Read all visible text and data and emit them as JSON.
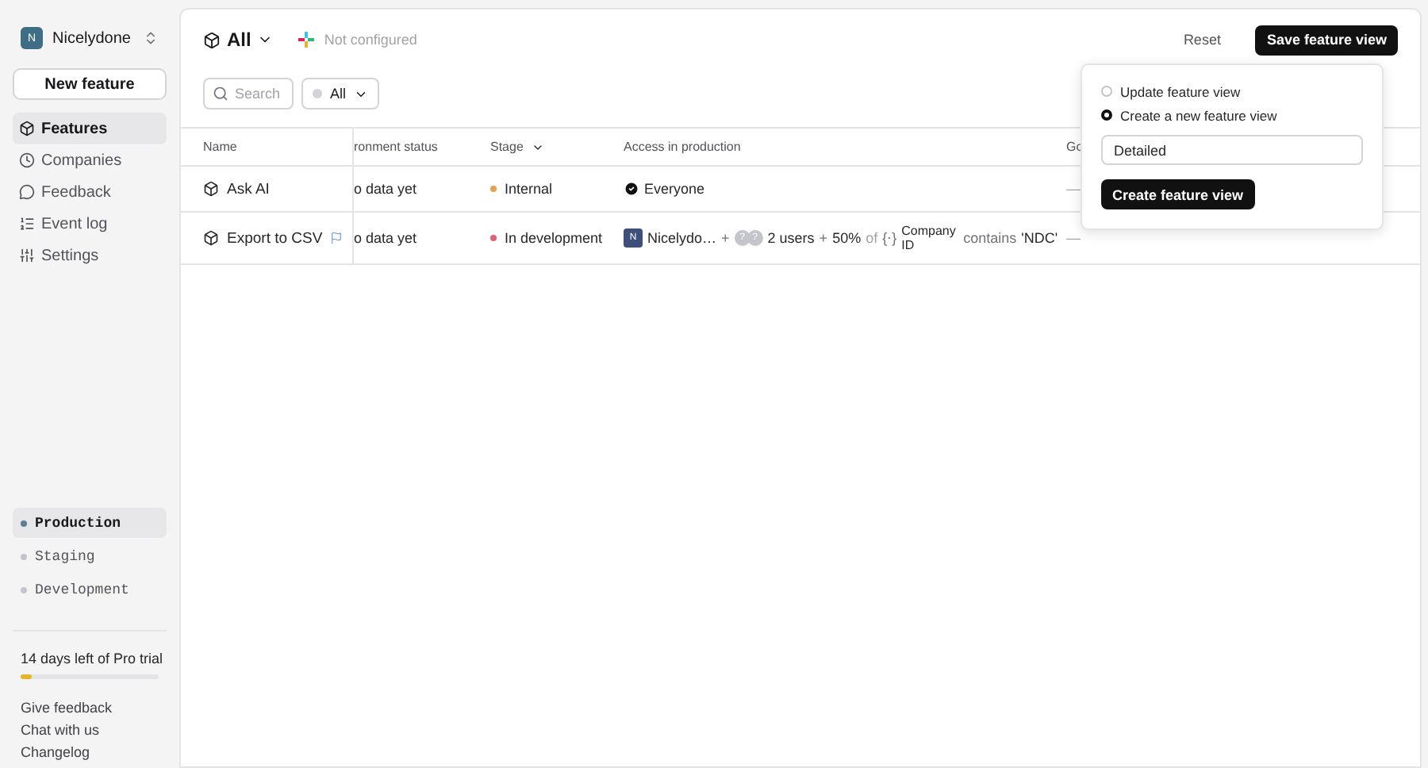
{
  "org": {
    "initial": "N",
    "name": "Nicelydone"
  },
  "new_feature": "New feature",
  "nav": [
    {
      "label": "Features",
      "selected": true
    },
    {
      "label": "Companies",
      "selected": false
    },
    {
      "label": "Feedback",
      "selected": false
    },
    {
      "label": "Event log",
      "selected": false
    },
    {
      "label": "Settings",
      "selected": false
    }
  ],
  "environments": [
    {
      "label": "Production",
      "selected": true
    },
    {
      "label": "Staging",
      "selected": false
    },
    {
      "label": "Development",
      "selected": false
    }
  ],
  "trial": {
    "text": "14 days left of Pro trial",
    "level": 0.08
  },
  "footer_links": [
    "Give feedback",
    "Chat with us",
    "Changelog"
  ],
  "header": {
    "view": "All",
    "slack": "Not configured",
    "reset": "Reset",
    "save": "Save feature view"
  },
  "filters": {
    "search_placeholder": "Search",
    "status": "All"
  },
  "table": {
    "columns": [
      "Name",
      "ronment status",
      "Stage",
      "Access in production",
      "Go"
    ],
    "rows": [
      {
        "name": "Ask AI",
        "flag": false,
        "env": "o data yet",
        "stage": {
          "label": "Internal",
          "color": "#e8a04c"
        },
        "access": {
          "kind": "everyone",
          "label": "Everyone"
        },
        "goal": "—"
      },
      {
        "name": "Export to CSV",
        "flag": true,
        "env": "o data yet",
        "stage": {
          "label": "In development",
          "color": "#e0607a"
        },
        "access": {
          "kind": "segments",
          "company_initial": "N",
          "company": "Nicelydo…",
          "plus": "+",
          "user_avatars": [
            "?",
            "?"
          ],
          "users": "2 users",
          "percent": "50%",
          "of": "of",
          "attr_icon": "{⋅}",
          "attribute": "Company ID",
          "operator": "contains",
          "value": "'NDC'"
        },
        "goal": "—"
      }
    ]
  },
  "popover": {
    "options": [
      {
        "label": "Update feature view",
        "selected": false
      },
      {
        "label": "Create a new feature view",
        "selected": true
      }
    ],
    "name_value": "Detailed",
    "submit": "Create feature view"
  }
}
